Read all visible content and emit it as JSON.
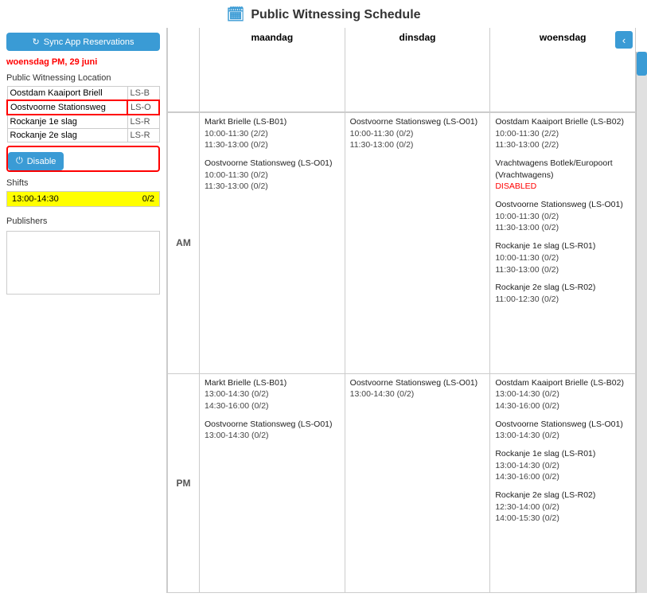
{
  "header": {
    "icon": "📅",
    "title": "Public Witnessing Schedule"
  },
  "sidebar": {
    "sync_button": "Sync App Reservations",
    "date": "woensdag PM, 29 juni",
    "location_section_title": "Public Witnessing Location",
    "locations": [
      {
        "name": "Oostdam Kaaiport Briell",
        "code": "LS-B"
      },
      {
        "name": "Oostvoorne Stationsweg",
        "code": "LS-O",
        "selected": true
      },
      {
        "name": "Rockanje 1e slag",
        "code": "LS-R"
      },
      {
        "name": "Rockanje 2e slag",
        "code": "LS-R"
      }
    ],
    "disable_button": "Disable",
    "shifts_title": "Shifts",
    "shifts": [
      {
        "time": "13:00-14:30",
        "count": "0/2"
      }
    ],
    "publishers_title": "Publishers"
  },
  "schedule": {
    "columns": [
      "maandag",
      "dinsdag",
      "woensdag"
    ],
    "am_label": "AM",
    "pm_label": "PM",
    "am_rows": {
      "maandag": [
        {
          "name": "Markt Brielle (LS-B01)",
          "times": [
            "10:00-11:30 (2/2)",
            "11:30-13:00 (0/2)"
          ]
        },
        {
          "name": "Oostvoorne Stationsweg (LS-O01)",
          "times": [
            "10:00-11:30 (0/2)",
            "11:30-13:00 (0/2)"
          ]
        }
      ],
      "dinsdag": [
        {
          "name": "Oostvoorne Stationsweg (LS-O01)",
          "times": [
            "10:00-11:30 (0/2)",
            "11:30-13:00 (0/2)"
          ]
        }
      ],
      "woensdag": [
        {
          "name": "Oostdam Kaaiport Brielle (LS-B02)",
          "times": [
            "10:00-11:30 (2/2)",
            "11:30-13:00 (2/2)"
          ]
        },
        {
          "name": "Vrachtwagens Botlek/Europoort (Vrachtwagens)",
          "times": [],
          "disabled": true,
          "disabled_label": "DISABLED"
        },
        {
          "name": "Oostvoorne Stationsweg (LS-O01)",
          "times": [
            "10:00-11:30 (0/2)",
            "11:30-13:00 (0/2)"
          ]
        },
        {
          "name": "Rockanje 1e slag (LS-R01)",
          "times": [
            "10:00-11:30 (0/2)",
            "11:30-13:00 (0/2)"
          ]
        },
        {
          "name": "Rockanje 2e slag (LS-R02)",
          "times": [
            "11:00-12:30 (0/2)"
          ]
        }
      ]
    },
    "pm_rows": {
      "maandag": [
        {
          "name": "Markt Brielle (LS-B01)",
          "times": [
            "13:00-14:30 (0/2)",
            "14:30-16:00 (0/2)"
          ]
        },
        {
          "name": "Oostvoorne Stationsweg (LS-O01)",
          "times": [
            "13:00-14:30 (0/2)"
          ]
        }
      ],
      "dinsdag": [
        {
          "name": "Oostvoorne Stationsweg (LS-O01)",
          "times": [
            "13:00-14:30 (0/2)"
          ]
        }
      ],
      "woensdag": [
        {
          "name": "Oostdam Kaaiport Brielle (LS-B02)",
          "times": [
            "13:00-14:30 (0/2)",
            "14:30-16:00 (0/2)"
          ]
        },
        {
          "name": "Oostvoorne Stationsweg (LS-O01)",
          "times": [
            "13:00-14:30 (0/2)"
          ]
        },
        {
          "name": "Rockanje 1e slag (LS-R01)",
          "times": [
            "13:00-14:30 (0/2)",
            "14:30-16:00 (0/2)"
          ]
        },
        {
          "name": "Rockanje 2e slag (LS-R02)",
          "times": [
            "12:30-14:00 (0/2)",
            "14:00-15:30 (0/2)"
          ]
        }
      ]
    }
  }
}
